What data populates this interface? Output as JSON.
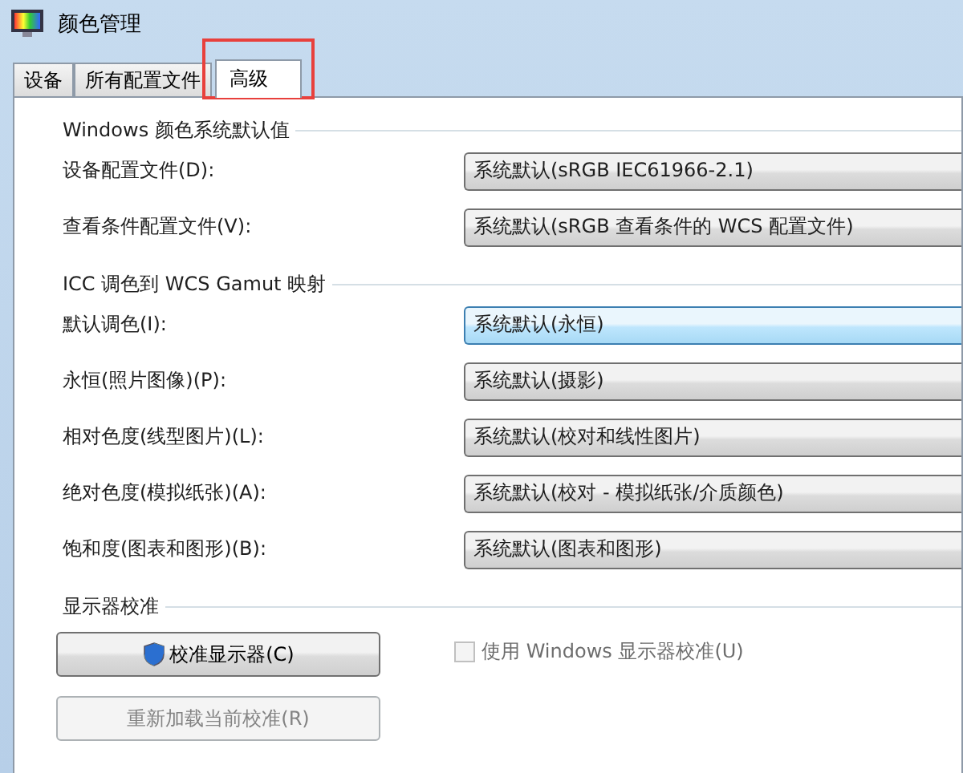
{
  "window": {
    "title": "颜色管理"
  },
  "tabs": [
    {
      "label": "设备",
      "selected": false,
      "highlighted": false
    },
    {
      "label": "所有配置文件",
      "selected": false,
      "highlighted": false
    },
    {
      "label": "高级",
      "selected": true,
      "highlighted": true
    }
  ],
  "groups": [
    {
      "title": "Windows 颜色系统默认值",
      "rows": [
        {
          "label": "设备配置文件(D):",
          "value": "系统默认(sRGB IEC61966-2.1)",
          "focused": false
        },
        {
          "label": "查看条件配置文件(V):",
          "value": "系统默认(sRGB 查看条件的 WCS 配置文件)",
          "focused": false
        }
      ]
    },
    {
      "title": "ICC 调色到 WCS Gamut 映射",
      "rows": [
        {
          "label": "默认调色(I):",
          "value": "系统默认(永恒)",
          "focused": true
        },
        {
          "label": "永恒(照片图像)(P):",
          "value": "系统默认(摄影)",
          "focused": false
        },
        {
          "label": "相对色度(线型图片)(L):",
          "value": "系统默认(校对和线性图片)",
          "focused": false
        },
        {
          "label": "绝对色度(模拟纸张)(A):",
          "value": "系统默认(校对 - 模拟纸张/介质颜色)",
          "focused": false
        },
        {
          "label": "饱和度(图表和图形)(B):",
          "value": "系统默认(图表和图形)",
          "focused": false
        }
      ]
    }
  ],
  "calibration": {
    "title": "显示器校准",
    "buttons": [
      {
        "label": "校准显示器(C)",
        "disabled": false,
        "shield": true
      },
      {
        "label": "重新加载当前校准(R)",
        "disabled": true,
        "shield": false
      }
    ],
    "checkbox": {
      "label": "使用 Windows 显示器校准(U)",
      "checked": false,
      "disabled": true
    }
  }
}
